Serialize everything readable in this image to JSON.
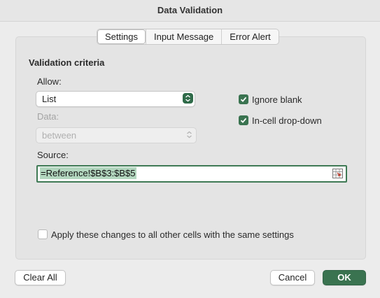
{
  "window": {
    "title": "Data Validation"
  },
  "tabs": [
    {
      "label": "Settings",
      "active": true
    },
    {
      "label": "Input Message",
      "active": false
    },
    {
      "label": "Error Alert",
      "active": false
    }
  ],
  "settings": {
    "section_title": "Validation criteria",
    "allow_label": "Allow:",
    "allow_value": "List",
    "data_label": "Data:",
    "data_value": "between",
    "source_label": "Source:",
    "source_value": "=Reference!$B$3:$B$5",
    "ignore_blank": {
      "label": "Ignore blank",
      "checked": true
    },
    "in_cell_dropdown": {
      "label": "In-cell drop-down",
      "checked": true
    },
    "apply_all": {
      "label": "Apply these changes to all other cells with the same settings",
      "checked": false
    }
  },
  "buttons": {
    "clear_all": "Clear All",
    "cancel": "Cancel",
    "ok": "OK"
  },
  "colors": {
    "accent": "#3a7350",
    "source_highlight": "#b3d7bf"
  }
}
